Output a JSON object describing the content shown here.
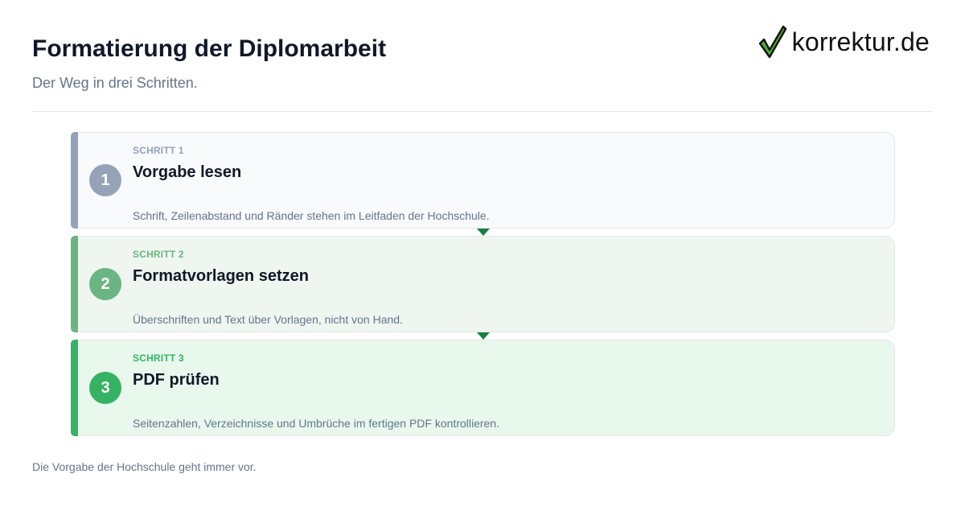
{
  "header": {
    "title": "Formatierung der Diplomarbeit",
    "subtitle": "Der Weg in drei Schritten."
  },
  "logo": {
    "text": "korrektur.de",
    "icon": "checkmark-icon"
  },
  "steps": [
    {
      "number": "1",
      "kicker": "SCHRITT 1",
      "title": "Vorgabe lesen",
      "description": "Schrift, Zeilenabstand und Ränder stehen im Leitfaden der Hochschule.",
      "accent": "#94a3b8",
      "background": "#f8fafc"
    },
    {
      "number": "2",
      "kicker": "SCHRITT 2",
      "title": "Formatvorlagen setzen",
      "description": "Überschriften und Text über Vorlagen, nicht von Hand.",
      "accent": "#6bb583",
      "background": "#eff6f0"
    },
    {
      "number": "3",
      "kicker": "SCHRITT 3",
      "title": "PDF prüfen",
      "description": "Seitenzahlen, Verzeichnisse und Umbrüche im fertigen PDF kontrollieren.",
      "accent": "#36b265",
      "background": "#e8f8ec"
    }
  ],
  "connector_color": "#15803d",
  "footnote": "Die Vorgabe der Hochschule geht immer vor."
}
